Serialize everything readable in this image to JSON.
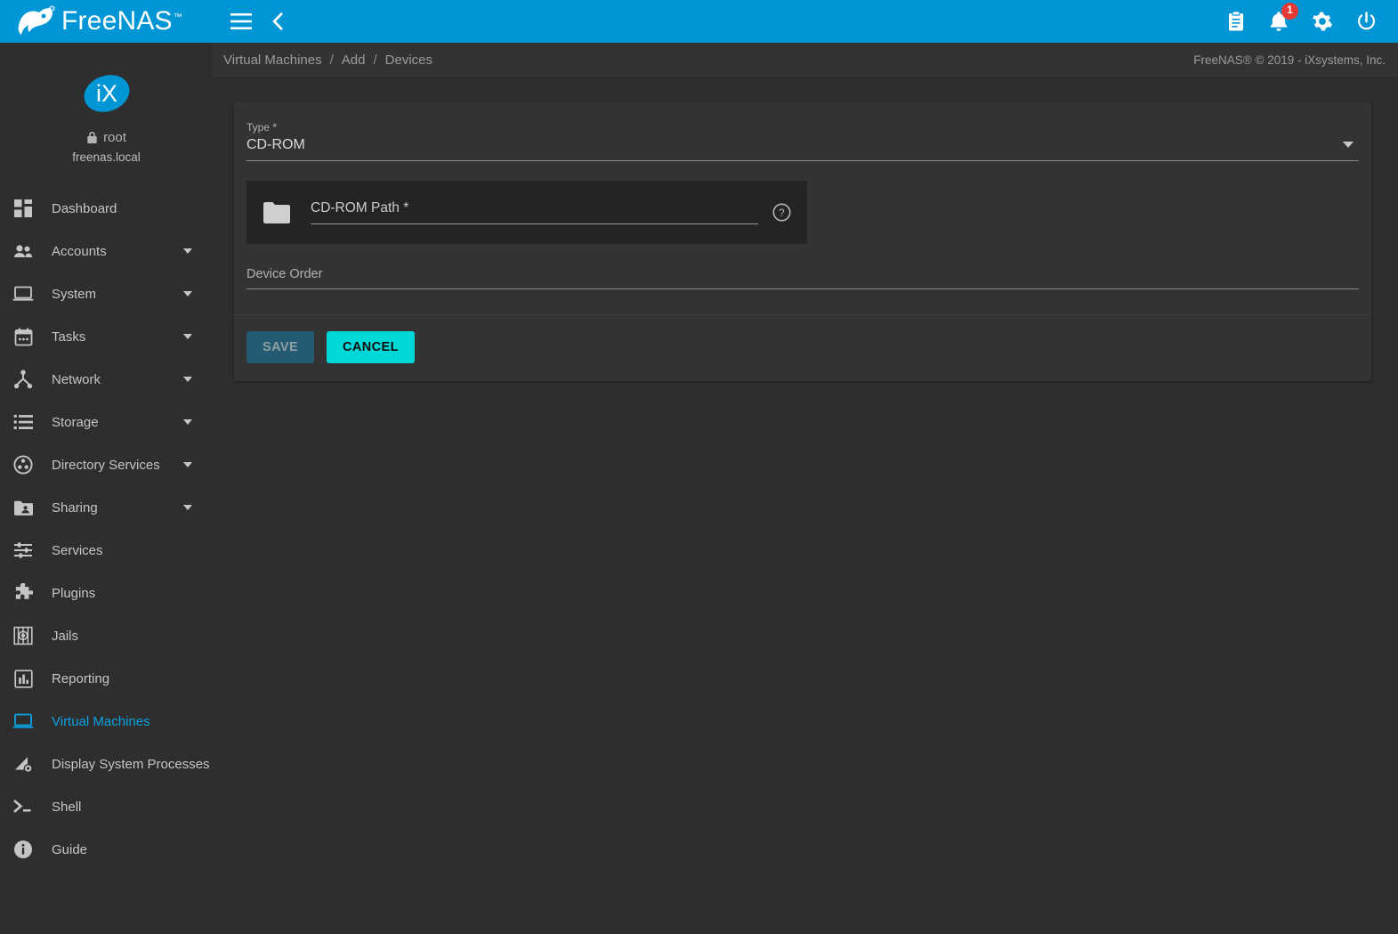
{
  "brand": {
    "name": "FreeNAS",
    "trademark": "™",
    "logo_icon": "freenas-fish-logo",
    "accent_color": "#0095d5"
  },
  "topbar": {
    "menu_icon": "hamburger-menu-icon",
    "back_icon": "chevron-left-icon",
    "actions": [
      {
        "name": "jobs-icon",
        "icon": "clipboard-icon",
        "badge": null
      },
      {
        "name": "notifications-icon",
        "icon": "bell-icon",
        "badge": "1"
      },
      {
        "name": "settings-icon",
        "icon": "gear-icon",
        "badge": null
      },
      {
        "name": "power-icon",
        "icon": "power-icon",
        "badge": null
      }
    ]
  },
  "breadcrumb": {
    "items": [
      "Virtual Machines",
      "Add",
      "Devices"
    ],
    "separator": "/"
  },
  "footer": {
    "copyright": "FreeNAS® © 2019 - iXsystems, Inc."
  },
  "sidebar": {
    "avatar_text": "iX",
    "lock_icon": "lock-icon",
    "username": "root",
    "hostname": "freenas.local",
    "items": [
      {
        "label": "Dashboard",
        "icon": "dashboard-icon",
        "expandable": false,
        "active": false
      },
      {
        "label": "Accounts",
        "icon": "people-icon",
        "expandable": true,
        "active": false
      },
      {
        "label": "System",
        "icon": "laptop-icon",
        "expandable": true,
        "active": false
      },
      {
        "label": "Tasks",
        "icon": "calendar-icon",
        "expandable": true,
        "active": false
      },
      {
        "label": "Network",
        "icon": "network-tree-icon",
        "expandable": true,
        "active": false
      },
      {
        "label": "Storage",
        "icon": "storage-list-icon",
        "expandable": true,
        "active": false
      },
      {
        "label": "Directory Services",
        "icon": "directory-reel-icon",
        "expandable": true,
        "active": false
      },
      {
        "label": "Sharing",
        "icon": "shared-folder-icon",
        "expandable": true,
        "active": false
      },
      {
        "label": "Services",
        "icon": "sliders-icon",
        "expandable": false,
        "active": false
      },
      {
        "label": "Plugins",
        "icon": "puzzle-piece-icon",
        "expandable": false,
        "active": false
      },
      {
        "label": "Jails",
        "icon": "jail-bars-icon",
        "expandable": false,
        "active": false
      },
      {
        "label": "Reporting",
        "icon": "bar-chart-icon",
        "expandable": false,
        "active": false
      },
      {
        "label": "Virtual Machines",
        "icon": "monitor-icon",
        "expandable": false,
        "active": true
      },
      {
        "label": "Display System Processes",
        "icon": "processes-gear-icon",
        "expandable": false,
        "active": false
      },
      {
        "label": "Shell",
        "icon": "terminal-prompt-icon",
        "expandable": false,
        "active": false
      },
      {
        "label": "Guide",
        "icon": "info-circle-icon",
        "expandable": false,
        "active": false
      }
    ]
  },
  "form": {
    "type_field": {
      "label": "Type *",
      "value": "CD-ROM",
      "caret_icon": "chevron-down-icon"
    },
    "cdrom_path": {
      "folder_icon": "folder-icon",
      "placeholder": "CD-ROM Path *",
      "value": "",
      "help_icon": "help-circle-icon"
    },
    "device_order": {
      "label": "Device Order",
      "value": ""
    },
    "buttons": {
      "save_label": "SAVE",
      "save_disabled": true,
      "cancel_label": "CANCEL"
    }
  }
}
